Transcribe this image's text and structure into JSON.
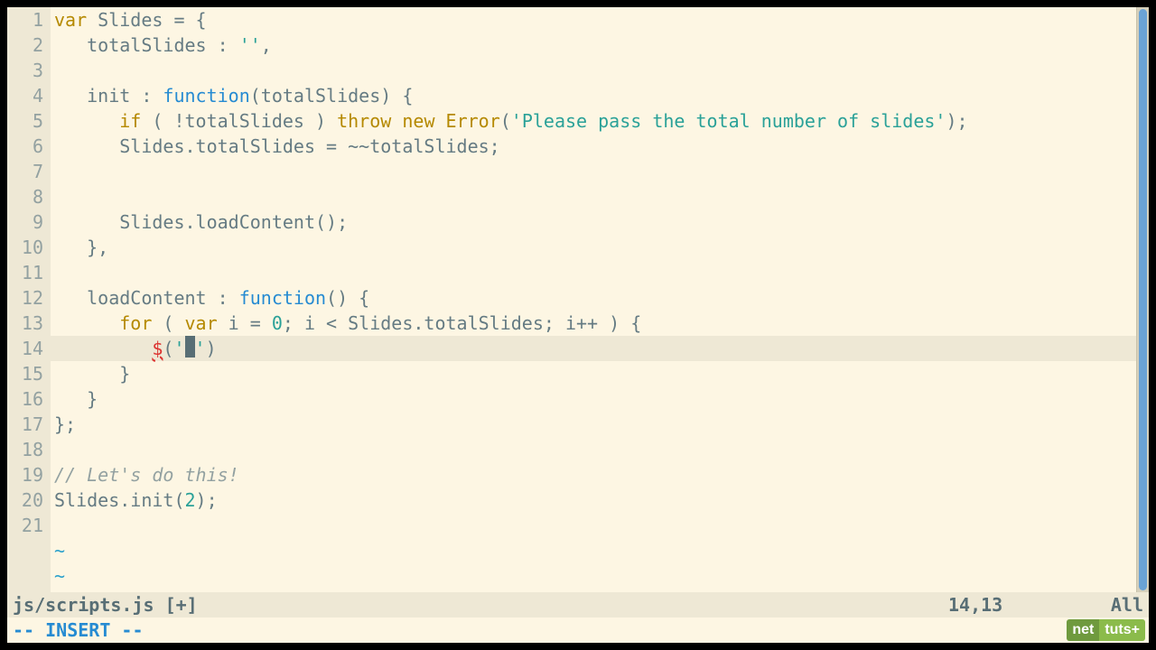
{
  "editor": {
    "filename": "js/scripts.js [+]",
    "cursor_position": "14,13",
    "scroll_percent": "All",
    "mode_line": "-- INSERT --",
    "total_lines": 21,
    "current_line": 14,
    "tilde_rows": 2,
    "lines": {
      "l1": {
        "pre": "",
        "seg": [
          [
            "kw",
            "var"
          ],
          [
            "op",
            " Slides "
          ],
          [
            "op",
            "="
          ],
          [
            "op",
            " {"
          ]
        ]
      },
      "l2": {
        "pre": "   ",
        "seg": [
          [
            "id",
            "totalSlides : "
          ],
          [
            "str",
            "''"
          ],
          [
            "op",
            ","
          ]
        ]
      },
      "l3": {
        "pre": "",
        "seg": []
      },
      "l4": {
        "pre": "   ",
        "seg": [
          [
            "id",
            "init : "
          ],
          [
            "func",
            "function"
          ],
          [
            "op",
            "(totalSlides) {"
          ]
        ]
      },
      "l5": {
        "pre": "      ",
        "seg": [
          [
            "kw",
            "if"
          ],
          [
            "op",
            " ( "
          ],
          [
            "op",
            "!"
          ],
          [
            "id",
            "totalSlides ) "
          ],
          [
            "kw",
            "throw"
          ],
          [
            "op",
            " "
          ],
          [
            "kw",
            "new"
          ],
          [
            "op",
            " "
          ],
          [
            "cls",
            "Error"
          ],
          [
            "op",
            "("
          ],
          [
            "str",
            "'Please pass the total number of slides'"
          ],
          [
            "op",
            ");"
          ]
        ]
      },
      "l6": {
        "pre": "      ",
        "seg": [
          [
            "id",
            "Slides.totalSlides = "
          ],
          [
            "op",
            "~~"
          ],
          [
            "id",
            "totalSlides;"
          ]
        ]
      },
      "l7": {
        "pre": "",
        "seg": []
      },
      "l8": {
        "pre": "",
        "seg": []
      },
      "l9": {
        "pre": "      ",
        "seg": [
          [
            "id",
            "Slides.loadContent();"
          ]
        ]
      },
      "l10": {
        "pre": "   ",
        "seg": [
          [
            "op",
            "},"
          ]
        ]
      },
      "l11": {
        "pre": "",
        "seg": []
      },
      "l12": {
        "pre": "   ",
        "seg": [
          [
            "id",
            "loadContent : "
          ],
          [
            "func",
            "function"
          ],
          [
            "op",
            "() {"
          ]
        ]
      },
      "l13": {
        "pre": "      ",
        "seg": [
          [
            "kw",
            "for"
          ],
          [
            "op",
            " ( "
          ],
          [
            "kw",
            "var"
          ],
          [
            "op",
            " i = "
          ],
          [
            "num",
            "0"
          ],
          [
            "op",
            "; i < Slides.totalSlides; i++ ) {"
          ]
        ]
      },
      "l14": {
        "pre": "         ",
        "seg": [
          [
            "err",
            "$"
          ],
          [
            "op",
            "("
          ],
          [
            "str",
            "'"
          ],
          [
            "cursor",
            ""
          ],
          [
            "str",
            "'"
          ],
          [
            "op",
            ")"
          ]
        ]
      },
      "l15": {
        "pre": "      ",
        "seg": [
          [
            "op",
            "}"
          ]
        ]
      },
      "l16": {
        "pre": "   ",
        "seg": [
          [
            "op",
            "}"
          ]
        ]
      },
      "l17": {
        "pre": "",
        "seg": [
          [
            "op",
            "};"
          ]
        ]
      },
      "l18": {
        "pre": "",
        "seg": []
      },
      "l19": {
        "pre": "",
        "seg": [
          [
            "cmt",
            "// Let's do this!"
          ]
        ]
      },
      "l20": {
        "pre": "",
        "seg": [
          [
            "id",
            "Slides.init("
          ],
          [
            "num",
            "2"
          ],
          [
            "op",
            ");"
          ]
        ]
      },
      "l21": {
        "pre": "",
        "seg": []
      }
    }
  },
  "logo": {
    "left": "net",
    "right": "tuts+"
  }
}
